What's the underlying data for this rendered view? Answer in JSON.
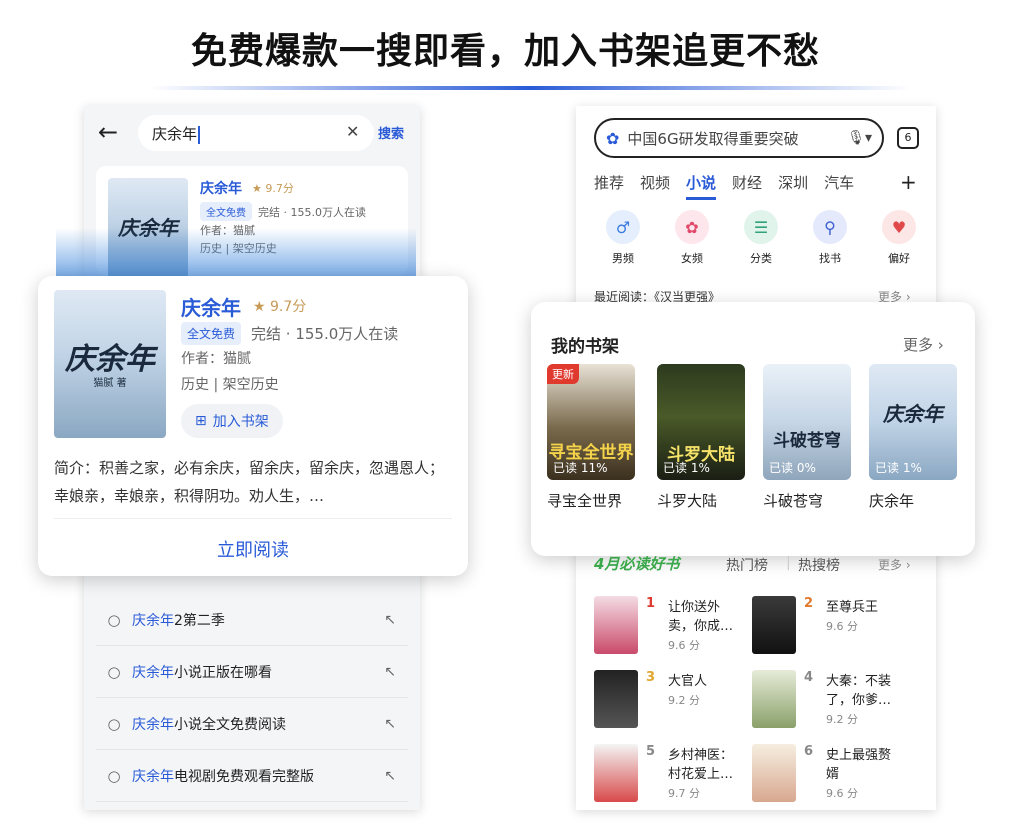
{
  "headline": "免费爆款一搜即看，加入书架追更不愁",
  "left": {
    "search_value": "庆余年",
    "search_button": "搜索",
    "book": {
      "title": "庆余年",
      "rating": "9.7分",
      "free_tag": "全文免费",
      "status": "完结 · 155.0万人在读",
      "author": "作者：猫腻",
      "category1": "历史",
      "category2": "架空历史",
      "add_shelf": "加入书架",
      "cover_title": "庆余年",
      "cover_author": "猫腻 著",
      "intro": "简介：积善之家，必有余庆，留余庆，留余庆，忽遇恩人；幸娘亲，幸娘亲，积得阴功。劝人生，…",
      "read_now": "立即阅读"
    },
    "suggestions": [
      {
        "hl": "庆余年",
        "rest": "2第二季"
      },
      {
        "hl": "庆余年",
        "rest": "小说正版在哪看"
      },
      {
        "hl": "庆余年",
        "rest": "小说全文免费阅读"
      },
      {
        "hl": "庆余年",
        "rest": "电视剧免费观看完整版"
      }
    ]
  },
  "right": {
    "search_text": "中国6G研发取得重要突破",
    "tab_count": "6",
    "tabs": [
      "推荐",
      "视频",
      "小说",
      "财经",
      "深圳",
      "汽车"
    ],
    "icons": [
      {
        "label": "男频",
        "color": "#3b7be0"
      },
      {
        "label": "女频",
        "color": "#e04a6a"
      },
      {
        "label": "分类",
        "color": "#2fa27a"
      },
      {
        "label": "找书",
        "color": "#3b5fd0"
      },
      {
        "label": "偏好",
        "color": "#e0484a"
      }
    ],
    "recent": "最近阅读：《汉当更强》",
    "recent_more": "更多",
    "shelf": {
      "title": "我的书架",
      "more": "更多",
      "books": [
        {
          "name": "寻宝全世界",
          "progress": "已读 11%",
          "badge": "更新",
          "cover_text": "寻宝全世界"
        },
        {
          "name": "斗罗大陆",
          "progress": "已读 1%",
          "cover_text": "斗罗大陆"
        },
        {
          "name": "斗破苍穹",
          "progress": "已读 0%",
          "cover_text": "斗破苍穹"
        },
        {
          "name": "庆余年",
          "progress": "已读 1%",
          "cover_text": "庆余年"
        }
      ]
    },
    "board": {
      "banner": "4月必读好书",
      "tab1": "热门榜",
      "tab2": "热搜榜",
      "more": "更多"
    },
    "ranks": [
      {
        "n": "1",
        "t1": "让你送外",
        "t2": "卖，你成…",
        "score": "9.6 分"
      },
      {
        "n": "2",
        "t1": "至尊兵王",
        "t2": "",
        "score": "9.6 分"
      },
      {
        "n": "3",
        "t1": "大官人",
        "t2": "",
        "score": "9.2 分"
      },
      {
        "n": "4",
        "t1": "大秦：不装",
        "t2": "了，你爹…",
        "score": "9.2 分"
      },
      {
        "n": "5",
        "t1": "乡村神医：",
        "t2": "村花爱上…",
        "score": "9.7 分"
      },
      {
        "n": "6",
        "t1": "史上最强赘",
        "t2": "婿",
        "score": "9.6 分"
      }
    ]
  }
}
